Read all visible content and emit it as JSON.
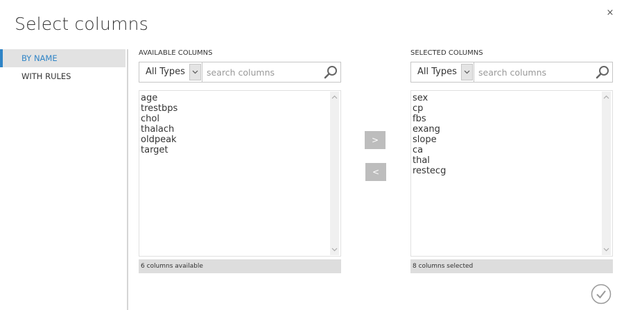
{
  "dialog": {
    "title": "Select columns",
    "close_label": "×"
  },
  "sidebar": {
    "items": [
      {
        "label": "BY NAME",
        "active": true
      },
      {
        "label": "WITH RULES",
        "active": false
      }
    ]
  },
  "available": {
    "header": "AVAILABLE COLUMNS",
    "type_filter": "All Types",
    "search_placeholder": "search columns",
    "columns": [
      "age",
      "trestbps",
      "chol",
      "thalach",
      "oldpeak",
      "target"
    ],
    "status": "6 columns available"
  },
  "selected": {
    "header": "SELECTED COLUMNS",
    "type_filter": "All Types",
    "search_placeholder": "search columns",
    "columns": [
      "sex",
      "cp",
      "fbs",
      "exang",
      "slope",
      "ca",
      "thal",
      "restecg"
    ],
    "status": "8 columns selected"
  },
  "actions": {
    "add_label": ">",
    "remove_label": "<"
  },
  "colors": {
    "accent": "#2f84c6",
    "button_gray": "#bdbdbd",
    "status_bg": "#dddddd"
  },
  "icons": {
    "close": "close-icon",
    "search": "search-icon",
    "chevron": "chevron-down-icon",
    "confirm": "checkmark-icon"
  }
}
